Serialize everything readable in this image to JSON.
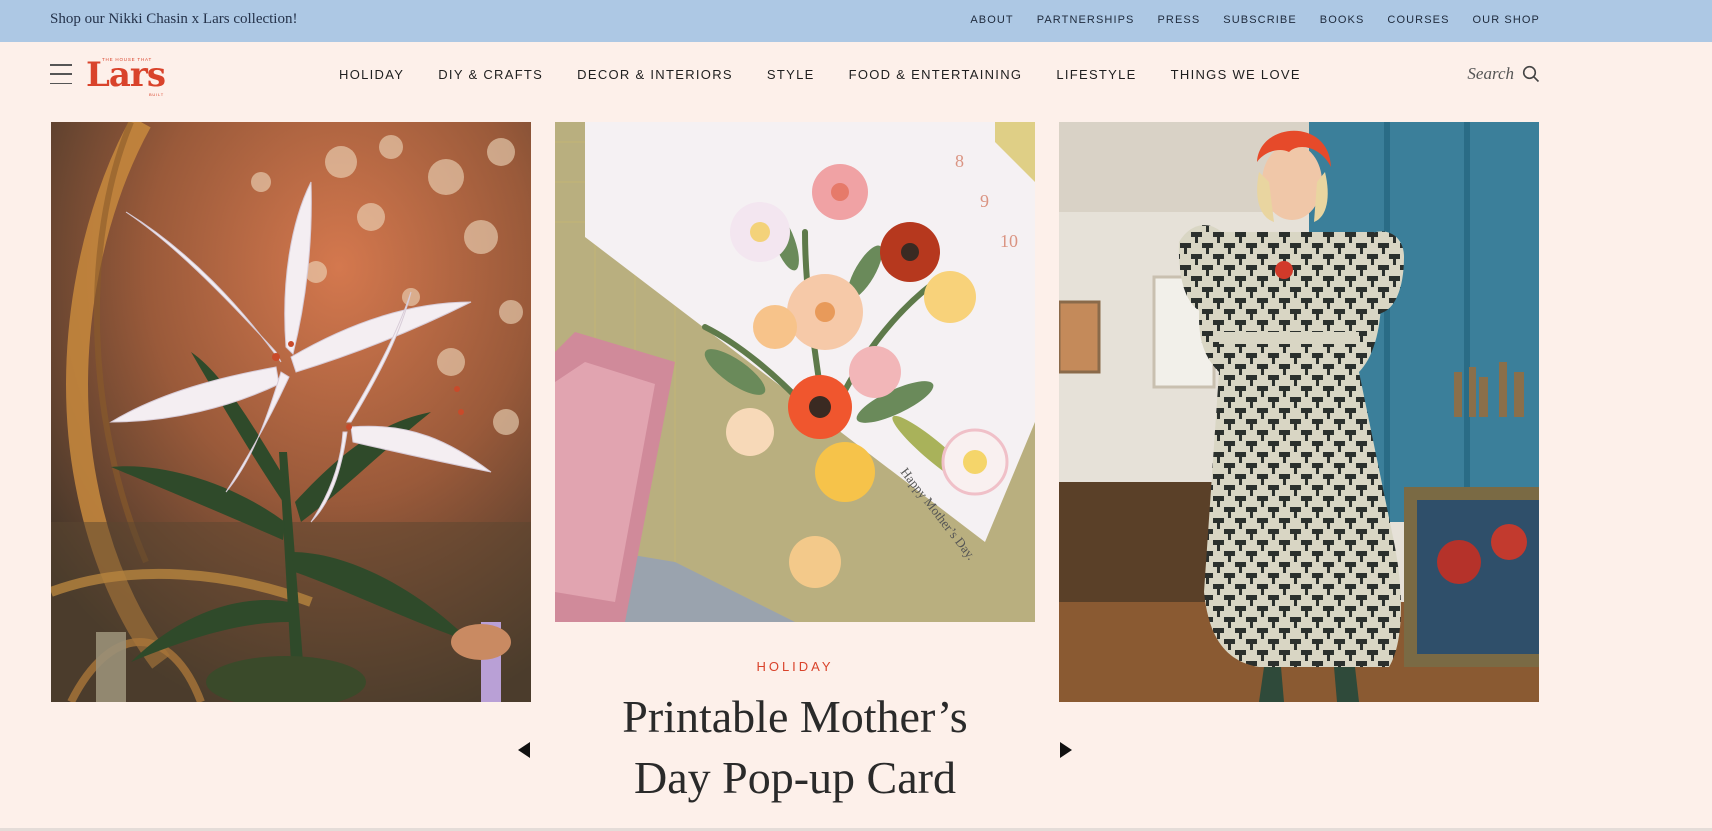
{
  "announcement": {
    "promo_text": "Shop our Nikki Chasin x Lars collection!",
    "links": [
      "ABOUT",
      "PARTNERSHIPS",
      "PRESS",
      "SUBSCRIBE",
      "BOOKS",
      "COURSES",
      "OUR SHOP"
    ]
  },
  "header": {
    "logo": {
      "tagline": "THE HOUSE THAT",
      "wordmark": "Lars",
      "subline": "BUILT"
    },
    "nav": [
      "HOLIDAY",
      "DIY & CRAFTS",
      "DECOR & INTERIORS",
      "STYLE",
      "FOOD & ENTERTAINING",
      "LIFESTYLE",
      "THINGS WE LOVE"
    ],
    "search_label": "Search"
  },
  "carousel": {
    "featured": {
      "category": "HOLIDAY",
      "title_line1": "Printable Mother’s",
      "title_line2": "Day Pop-up Card",
      "card_text": "Happy Mother’s Day."
    }
  },
  "colors": {
    "topbar": "#adc8e4",
    "page_background": "#fdf0ea",
    "accent": "#d9432b",
    "text": "#2a2a2a"
  },
  "icons": [
    "hamburger-menu-icon",
    "search-icon",
    "arrow-left-icon",
    "arrow-right-icon"
  ]
}
